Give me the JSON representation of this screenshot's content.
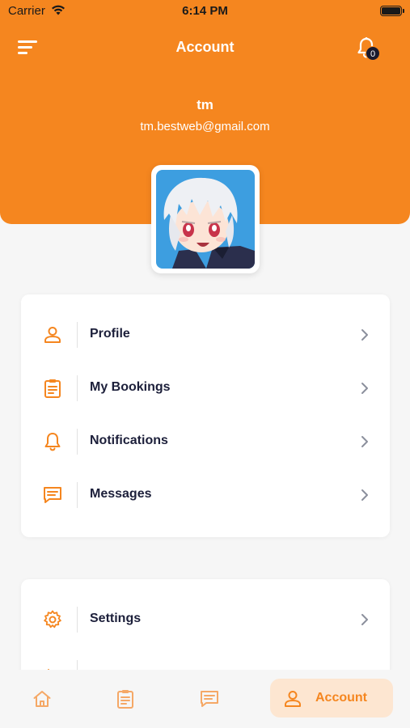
{
  "status_bar": {
    "carrier": "Carrier",
    "time": "6:14 PM"
  },
  "header": {
    "title": "Account",
    "notification_count": "0"
  },
  "user": {
    "name": "tm",
    "email": "tm.bestweb@gmail.com"
  },
  "menu_primary": [
    {
      "label": "Profile",
      "icon": "person-icon"
    },
    {
      "label": "My Bookings",
      "icon": "clipboard-icon"
    },
    {
      "label": "Notifications",
      "icon": "bell-icon"
    },
    {
      "label": "Messages",
      "icon": "message-icon"
    }
  ],
  "menu_secondary": [
    {
      "label": "Settings",
      "icon": "gear-icon"
    }
  ],
  "tabbar": {
    "account_label": "Account",
    "active_tab": "Account"
  },
  "colors": {
    "accent": "#f5861f",
    "accent_light": "#fde6d1",
    "text": "#1c1f3a",
    "background": "#f6f6f6"
  }
}
